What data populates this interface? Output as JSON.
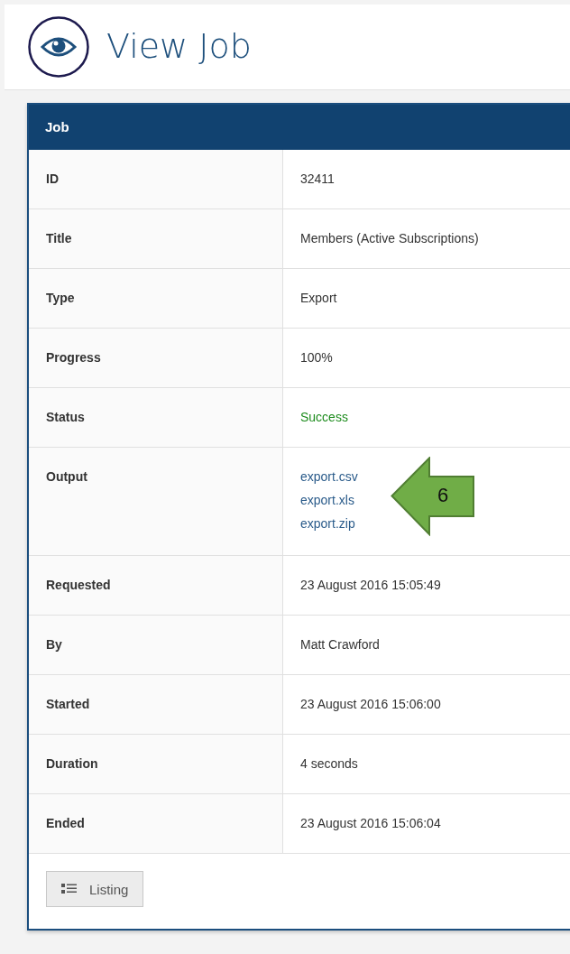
{
  "page": {
    "title": "View Job"
  },
  "panel": {
    "title": "Job",
    "rows": [
      {
        "label": "ID",
        "kind": "text",
        "value": "32411"
      },
      {
        "label": "Title",
        "kind": "text",
        "value": "Members (Active Subscriptions)"
      },
      {
        "label": "Type",
        "kind": "text",
        "value": "Export"
      },
      {
        "label": "Progress",
        "kind": "text",
        "value": "100%"
      },
      {
        "label": "Status",
        "kind": "status",
        "value": "Success",
        "color": "#1e8c1e"
      },
      {
        "label": "Output",
        "kind": "links",
        "links": [
          "export.csv",
          "export.xls",
          "export.zip"
        ]
      },
      {
        "label": "Requested",
        "kind": "text",
        "value": "23 August 2016 15:05:49"
      },
      {
        "label": "By",
        "kind": "text",
        "value": "Matt Crawford"
      },
      {
        "label": "Started",
        "kind": "text",
        "value": "23 August 2016 15:06:00"
      },
      {
        "label": "Duration",
        "kind": "text",
        "value": "4 seconds"
      },
      {
        "label": "Ended",
        "kind": "text",
        "value": "23 August 2016 15:06:04"
      }
    ],
    "button": "Listing"
  },
  "callout": {
    "text": "6"
  }
}
